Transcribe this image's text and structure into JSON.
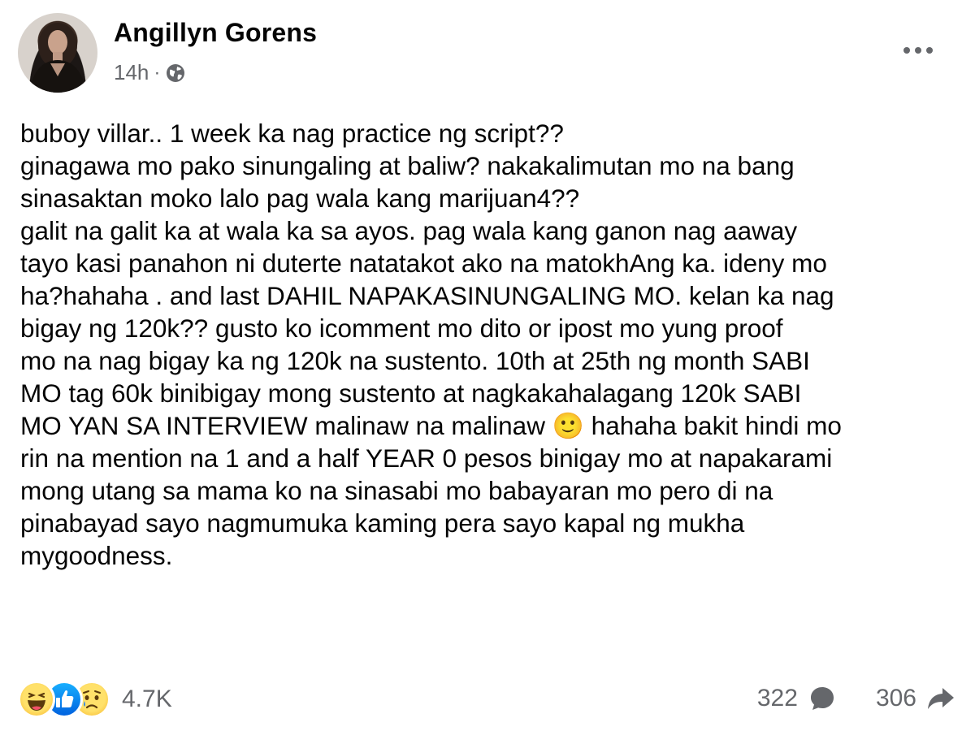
{
  "post": {
    "author": "Angillyn Gorens",
    "timestamp": "14h",
    "separator": "·",
    "privacy_icon": "globe-icon",
    "more_icon": "more-horizontal-icon",
    "body": "buboy villar.. 1 week ka nag practice ng script??\nginagawa mo pako sinungaling at baliw? nakakalimutan mo na bang\nsinasaktan moko lalo pag wala kang marijuan4??\ngalit na galit ka at wala ka sa ayos. pag wala kang ganon nag aaway\ntayo kasi panahon ni duterte natatakot ako na matokhAng ka. ideny mo\nha?hahaha . and last DAHIL NAPAKASINUNGALING MO. kelan ka nag\nbigay ng 120k?? gusto ko icomment mo dito or ipost mo yung proof\nmo na nag bigay ka ng 120k na sustento. 10th at 25th ng month SABI\nMO tag 60k binibigay mong sustento at nagkakahalagang 120k SABI\nMO YAN SA INTERVIEW malinaw na malinaw 🙂 hahaha bakit hindi mo\nrin na mention na 1 and a half YEAR 0 pesos binigay mo at napakarami\nmong utang sa mama ko na sinasabi mo babayaran mo pero di na\npinabayad sayo nagmumuka kaming pera sayo kapal ng mukha\nmygoodness."
  },
  "footer": {
    "reactions": [
      "haha-icon",
      "like-icon",
      "sad-icon"
    ],
    "reaction_count": "4.7K",
    "comments_count": "322",
    "comment_icon": "comment-icon",
    "shares_count": "306",
    "share_icon": "share-icon"
  },
  "colors": {
    "text_primary": "#050505",
    "text_secondary": "#65676b",
    "like_blue": "#0866ff",
    "reaction_yellow": "#f7b125"
  }
}
